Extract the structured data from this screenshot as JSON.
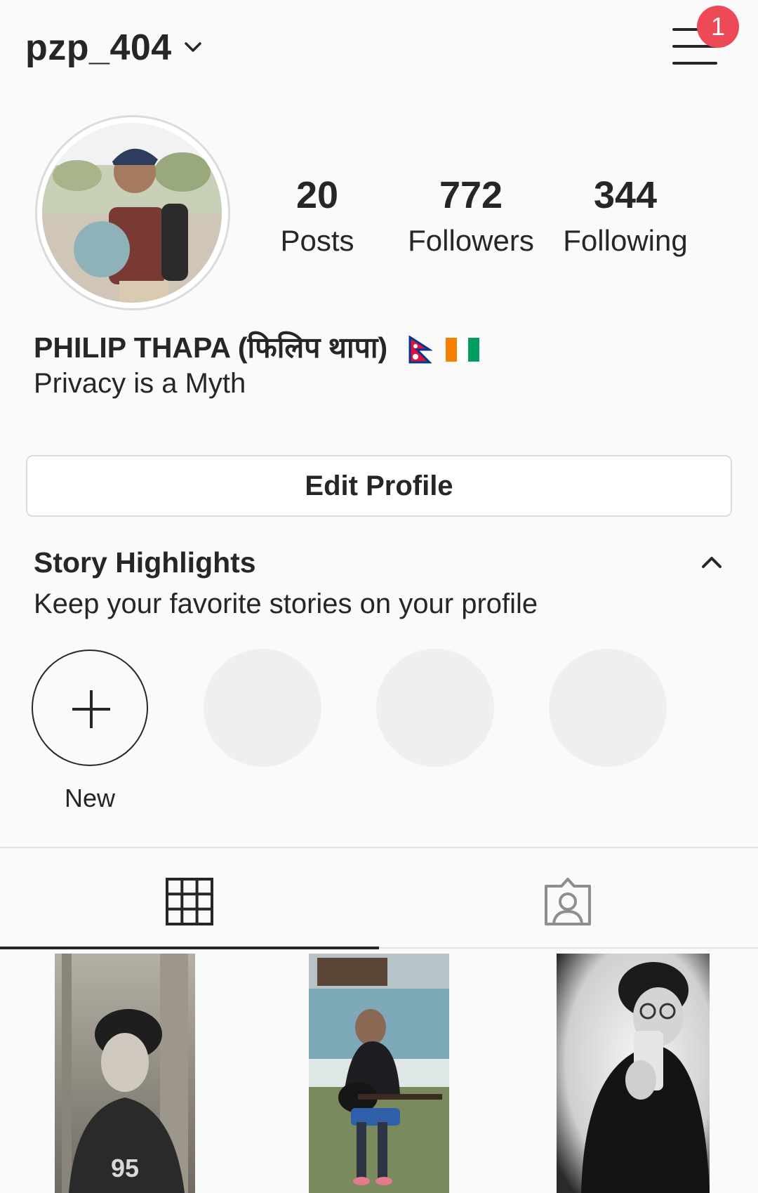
{
  "header": {
    "username": "pzp_404",
    "notification_count": "1"
  },
  "profile": {
    "posts_count": "20",
    "posts_label": "Posts",
    "followers_count": "772",
    "followers_label": "Followers",
    "following_count": "344",
    "following_label": "Following",
    "full_name": "PHILIP THAPA (फिलिप थापा)",
    "bio": "Privacy is a Myth",
    "flags": [
      "flag-nepal-icon",
      "flag-cote-divoire-icon"
    ]
  },
  "edit_profile_label": "Edit Profile",
  "highlights": {
    "title": "Story Highlights",
    "subtitle": "Keep your favorite stories on your profile",
    "new_label": "New"
  },
  "tabs": [
    "grid-icon",
    "tagged-icon"
  ],
  "colors": {
    "badge": "#ed4956",
    "text": "#262626",
    "border": "#dbdbdb",
    "background": "#fafafa",
    "placeholder": "#efefef"
  }
}
